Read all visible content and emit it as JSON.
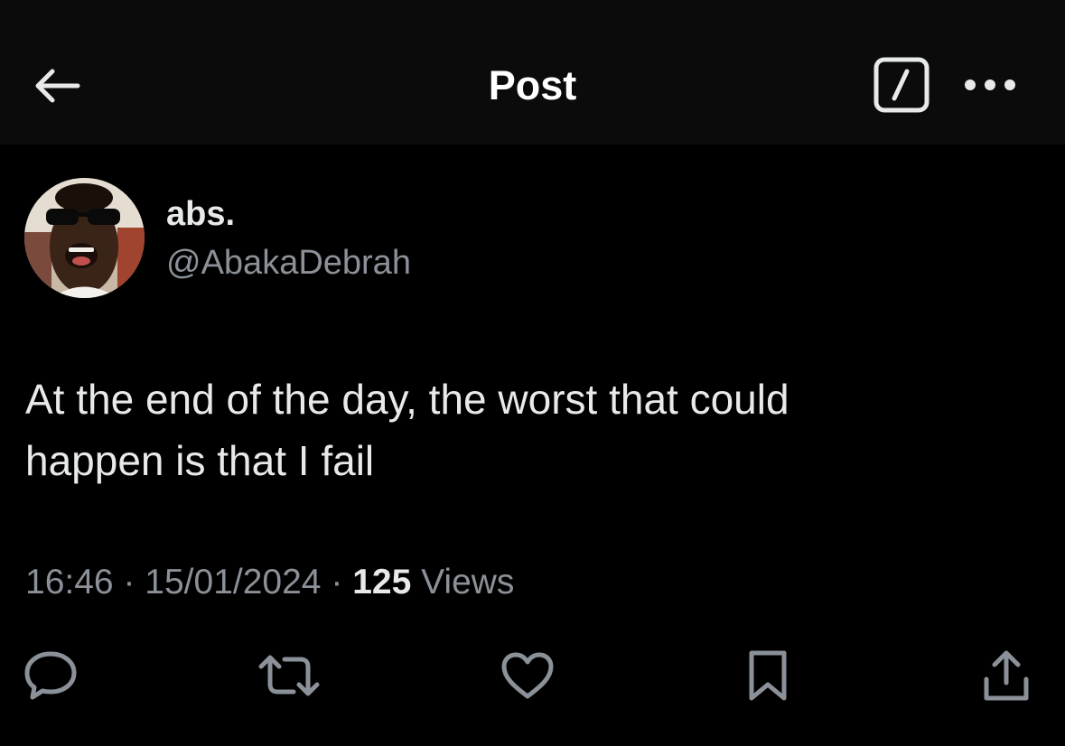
{
  "header": {
    "title": "Post",
    "back_icon": "arrow-left-icon",
    "compose_icon": "compose-icon",
    "more_icon": "more-horizontal-icon"
  },
  "post": {
    "author": {
      "display_name": "abs.",
      "handle": "@AbakaDebrah"
    },
    "text_lines": [
      "At the end of the day, the worst that could",
      "happen is that I fail"
    ],
    "time": "16:46",
    "date": "15/01/2024",
    "separator": "·",
    "views_count": "125",
    "views_label": "Views"
  },
  "actions": [
    {
      "icon": "reply-icon"
    },
    {
      "icon": "repost-icon"
    },
    {
      "icon": "like-icon"
    },
    {
      "icon": "bookmark-icon"
    },
    {
      "icon": "share-icon"
    }
  ],
  "colors": {
    "background": "#000000",
    "header_background": "#0b0b0b",
    "text_primary": "#e7e9ea",
    "text_secondary": "#8b9198",
    "icon": "#8b9198"
  }
}
